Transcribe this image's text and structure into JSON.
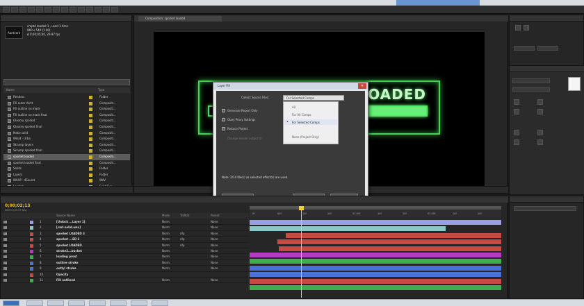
{
  "colors": {
    "glow_green": "#49d15a",
    "timecode": "#e8c020",
    "playhead": "#f0d040",
    "bar_lavender": "#9aa0e6",
    "bar_teal": "#8ec7c7",
    "bar_red": "#c84a44",
    "bar_magenta": "#b43cc0",
    "bar_green": "#3fae4f",
    "bar_blue": "#4a72d8"
  },
  "project": {
    "thumb_label": "Aardvark",
    "info_lines": [
      "cmptd loaded 1 , used 1 time",
      "960 x 540 (1.00)",
      "Δ 0;00;05;00, 29.97 fps"
    ],
    "col_name": "Name",
    "col_type": "Type",
    "items": [
      {
        "name": "Renders",
        "type": "Folder"
      },
      {
        "name": "Fill outer Vertt",
        "type": "Compositi..."
      },
      {
        "name": "Fill outline no mask",
        "type": "Compositi..."
      },
      {
        "name": "Fill outline no mask final",
        "type": "Compositi..."
      },
      {
        "name": "Gloomy sporket",
        "type": "Compositi..."
      },
      {
        "name": "Gloomy sporket final",
        "type": "Compositi..."
      },
      {
        "name": "Make solid",
        "type": "Compositi..."
      },
      {
        "name": "Wikat - Urba",
        "type": "Compositi..."
      },
      {
        "name": "Skrump layers",
        "type": "Compositi..."
      },
      {
        "name": "Skrump sporket final",
        "type": "Compositi..."
      },
      {
        "name": "sporket loaded",
        "type": "Compositi..."
      },
      {
        "name": "sporket loaded final",
        "type": "Compositi..."
      },
      {
        "name": "Solids",
        "type": "Folder"
      },
      {
        "name": "Layers",
        "type": "Folder"
      },
      {
        "name": "WAAP - 4Sound",
        "type": "WAV"
      },
      {
        "name": "Loaded",
        "type": "Solid Fire"
      }
    ],
    "selected_index": 10
  },
  "viewer": {
    "tab_label": "Composition: sporket loaded",
    "glow_text": "OADED",
    "progress": 0.35
  },
  "dialog": {
    "title": "Layer Fill",
    "close_glyph": "✕",
    "field_label": "Collect Source Files:",
    "select_value": "For Selected Comps",
    "rows": [
      "Generate Report Only",
      "Obey Proxy Settings",
      "Reduce Project",
      "Change render output to"
    ],
    "dropdown_options": [
      "All",
      "For All Comps",
      "For Selected Comps",
      "",
      "None (Project Only)"
    ],
    "dropdown_current_index": 2,
    "note": "Note: 2/14 file(s) as selected effect(s) are used.",
    "btn_comments": "Comments...",
    "btn_collect": "Collect...",
    "btn_cancel": "Cancel"
  },
  "timeline": {
    "timecode": "0;00;02;13",
    "timecode_sub": "00073 (29.97 fps)",
    "col_source": "Source Name",
    "col_mode": "Mode",
    "col_trkmat": "TrkMat",
    "col_parent": "Parent",
    "ruler_labels": [
      "0f",
      "00f",
      "10f",
      "20f",
      "01:00f",
      "10f",
      "20f",
      "02:00f",
      "10f",
      "20f"
    ],
    "layers": [
      {
        "num": "1",
        "name": "[Unlock ...Layer 1]",
        "mode": "Norm",
        "trk": "",
        "parent": "None",
        "color": "#9aa0e6"
      },
      {
        "num": "2",
        "name": "[cmt-solid.wav]",
        "mode": "Norm",
        "trk": "",
        "parent": "None",
        "color": "#8ec7c7"
      },
      {
        "num": "3",
        "name": "sporket LOADED 3",
        "mode": "Norm",
        "trk": "Alp",
        "parent": "None",
        "color": "#c84a44"
      },
      {
        "num": "4",
        "name": "sporket ...ED 2",
        "mode": "Norm",
        "trk": "Alp",
        "parent": "None",
        "color": "#c84a44"
      },
      {
        "num": "5",
        "name": "sporket LOADED",
        "mode": "Norm",
        "trk": "Alp",
        "parent": "None",
        "color": "#c84a44"
      },
      {
        "num": "6",
        "name": "stroke2...bucket",
        "mode": "Norm",
        "trk": "",
        "parent": "None",
        "color": "#b43cc0"
      },
      {
        "num": "7",
        "name": "loading prost",
        "mode": "Norm",
        "trk": "",
        "parent": "None",
        "color": "#3fae4f"
      },
      {
        "num": "8",
        "name": "outline stroke",
        "mode": "Norm",
        "trk": "",
        "parent": "None",
        "color": "#4a72d8"
      },
      {
        "num": "9",
        "name": "outlyl stroke",
        "mode": "Norm",
        "trk": "",
        "parent": "None",
        "color": "#4a72d8"
      },
      {
        "num": "10",
        "name": "Opacity",
        "mode": "",
        "trk": "",
        "parent": "",
        "color": "#c84a44"
      },
      {
        "num": "11",
        "name": "Fill outlined",
        "mode": "Norm",
        "trk": "",
        "parent": "None",
        "color": "#3fae4f"
      }
    ]
  }
}
